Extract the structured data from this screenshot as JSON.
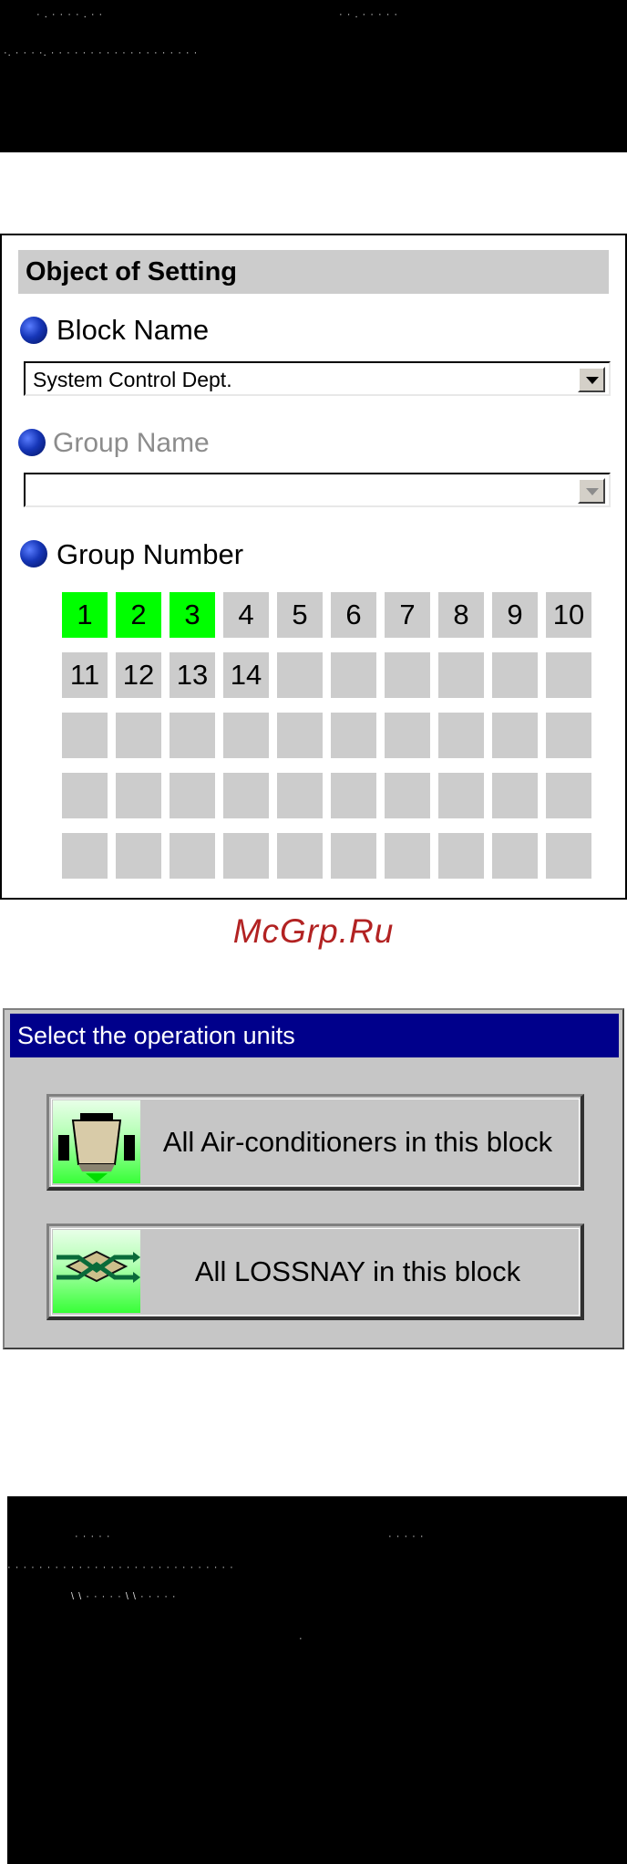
{
  "setting_panel": {
    "title": "Object of Setting",
    "block_name_label": "Block Name",
    "block_name_value": "System Control Dept.",
    "group_name_label": "Group Name",
    "group_name_value": "",
    "group_number_label": "Group Number",
    "group_numbers": [
      "1",
      "2",
      "3",
      "4",
      "5",
      "6",
      "7",
      "8",
      "9",
      "10",
      "11",
      "12",
      "13",
      "14",
      "",
      "",
      "",
      "",
      "",
      "",
      "",
      "",
      "",
      "",
      "",
      "",
      "",
      "",
      "",
      "",
      "",
      "",
      "",
      "",
      "",
      "",
      "",
      "",
      "",
      "",
      "",
      "",
      "",
      "",
      "",
      "",
      "",
      "",
      "",
      ""
    ],
    "selected_groups": [
      "1",
      "2",
      "3"
    ],
    "colors": {
      "selected": "#00ff00",
      "unselected": "#cccccc",
      "title_bar": "#cccccc"
    },
    "icons": [
      "bullet-icon",
      "dropdown-arrow-icon"
    ]
  },
  "watermark": "McGrp.Ru",
  "units_dialog": {
    "title": "Select the operation units",
    "buttons": [
      {
        "label": "All Air-conditioners in this block",
        "icon": "air-conditioner-icon"
      },
      {
        "label": "All LOSSNAY in this block",
        "icon": "lossnay-icon"
      }
    ],
    "colors": {
      "title_bar": "#00008b",
      "background": "#c6c6c6"
    }
  }
}
